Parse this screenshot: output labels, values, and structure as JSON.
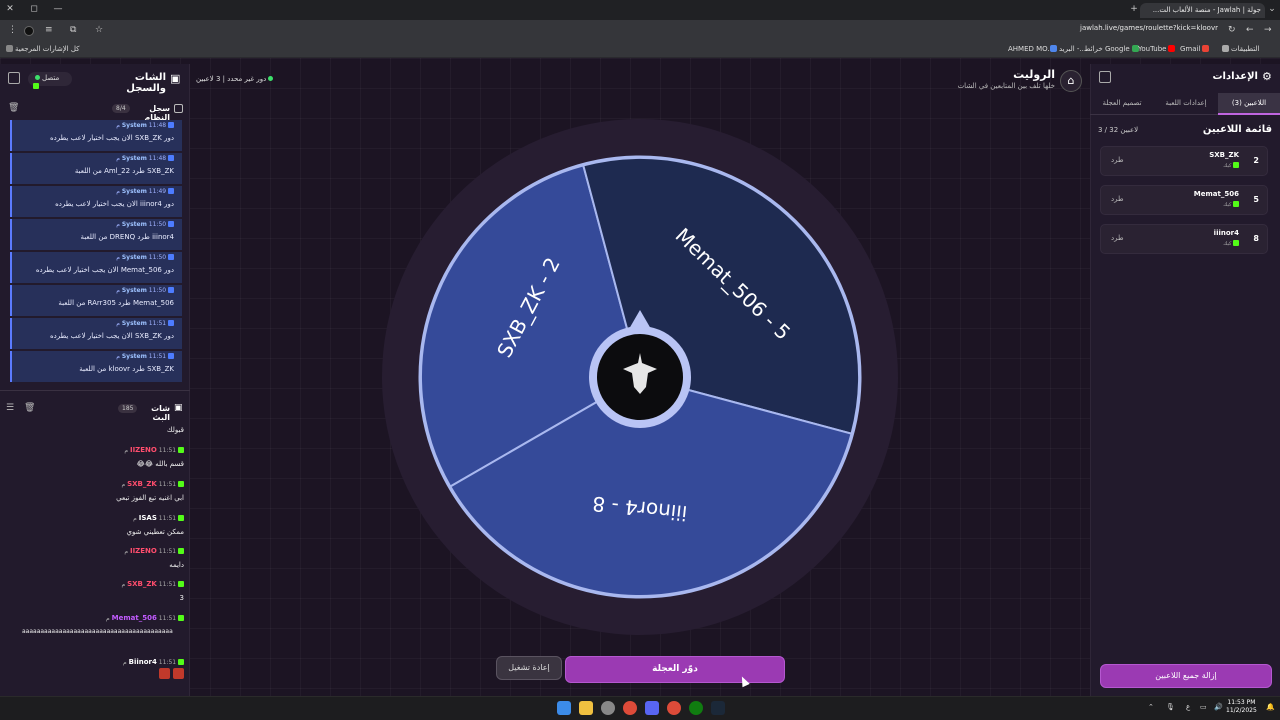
{
  "browser": {
    "tab_title": "جولة | Jawlah - منصة الألعاب الت...",
    "url": "jawlah.live/games/roulette?kick=kloovr",
    "bookmarks": [
      "كل الإشارات المرجعية",
      "AHMED MO...",
      "البريد -...",
      "خرائط Google",
      "YouTube",
      "Gmail",
      "التطبيقات"
    ]
  },
  "left_panel": {
    "title": "الشات والسجل",
    "online": "متصل",
    "system_log": {
      "title": "سجل النظام",
      "count": "8/4",
      "entries": [
        {
          "sender": "System",
          "time": "11:48 م",
          "text": "دور SXB_ZK الان يجب اختيار لاعب يطرده"
        },
        {
          "sender": "System",
          "time": "11:48 م",
          "text": "SXB_ZK طرد Aml_22 من اللعبة"
        },
        {
          "sender": "System",
          "time": "11:49 م",
          "text": "دور iiinor4 الان يجب اختيار لاعب يطرده"
        },
        {
          "sender": "System",
          "time": "11:50 م",
          "text": "iiinor4 طرد DRENQ من اللعبة"
        },
        {
          "sender": "System",
          "time": "11:50 م",
          "text": "دور Memat_506 الان يجب اختيار لاعب يطرده"
        },
        {
          "sender": "System",
          "time": "11:50 م",
          "text": "Memat_506 طرد RArr305 من اللعبة"
        },
        {
          "sender": "System",
          "time": "11:51 م",
          "text": "دور SXB_ZK الان يجب اختيار لاعب يطرده"
        },
        {
          "sender": "System",
          "time": "11:51 م",
          "text": "SXB_ZK طرد kloovr من اللعبة"
        }
      ]
    },
    "live_chat": {
      "title": "شات البث",
      "count": "185",
      "messages": [
        {
          "user": "",
          "time": "",
          "text": "قبولك",
          "color": "#ffffff"
        },
        {
          "user": "IIZENO",
          "time": "11:51 م",
          "text": "قسم بالله 😂😂",
          "color": "#ff4d6d"
        },
        {
          "user": "SXB_ZK",
          "time": "11:51 م",
          "text": "ابي اغنيه تبع الفوز تبعي",
          "color": "#ff4d6d"
        },
        {
          "user": "ISAS",
          "time": "11:51 م",
          "text": "ممكن تعطيني شوي",
          "color": "#ffffff"
        },
        {
          "user": "IIZENO",
          "time": "11:51 م",
          "text": "دايمه",
          "color": "#ff4d6d"
        },
        {
          "user": "SXB_ZK",
          "time": "11:51 م",
          "text": "3",
          "color": "#ff4d6d"
        },
        {
          "user": "Memat_506",
          "time": "11:51 م",
          "text": "aaaaaaaaaaaaaaaaaaaaaaaaaaaaaaaaaaaaaaaaa",
          "color": "#c25bff"
        },
        {
          "user": "Biinor4",
          "time": "11:51 م",
          "text": "",
          "color": "#ffffff"
        }
      ]
    }
  },
  "header": {
    "title": "الروليت",
    "subtitle": "خلها تلف بين المتابعين في الشات",
    "players_status": "3 لاعبين",
    "turn_status": "دور غير محدد"
  },
  "wheel": {
    "segments": [
      {
        "label": "SXB_ZK - 2",
        "color": "#354a99"
      },
      {
        "label": "Memat_506 - 5",
        "color": "#1e2a50"
      },
      {
        "label": "iiinor4 - 8",
        "color": "#354a99"
      }
    ]
  },
  "buttons": {
    "spin": "دوّر العجلة",
    "reset": "إعادة تشغيل",
    "clear_all": "إزالة جميع اللاعبين"
  },
  "right_panel": {
    "title": "الإعدادات",
    "tabs": [
      "اللاعبين (3)",
      "إعدادات اللعبة",
      "تصميم العجلة"
    ],
    "players_title": "قائمة اللاعبين",
    "players_count": "3 / 32 لاعبين",
    "players": [
      {
        "name": "SXB_ZK",
        "platform": "كيك",
        "number": "2",
        "kick": "طرد"
      },
      {
        "name": "Memat_506",
        "platform": "كيك",
        "number": "5",
        "kick": "طرد"
      },
      {
        "name": "iiinor4",
        "platform": "كيك",
        "number": "8",
        "kick": "طرد"
      }
    ]
  },
  "taskbar": {
    "time": "11:53 PM",
    "date": "11/2/2025",
    "lang": "ع"
  }
}
